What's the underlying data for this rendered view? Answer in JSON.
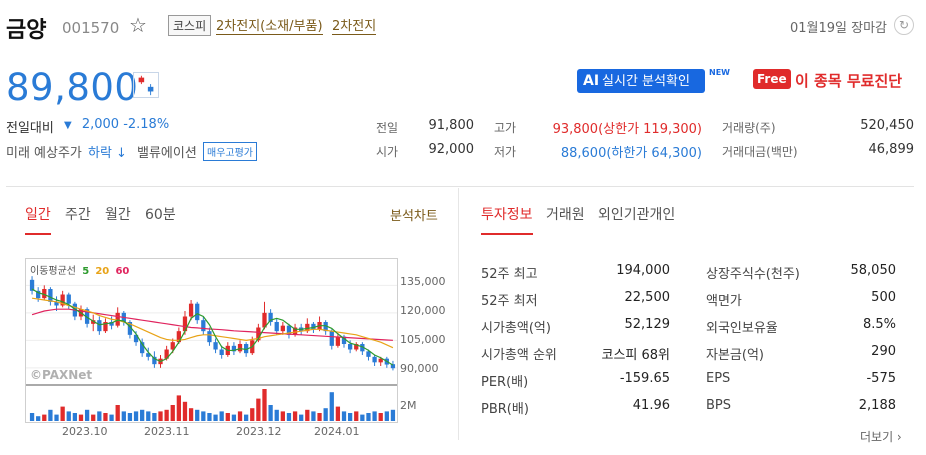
{
  "header": {
    "name": "금양",
    "code": "001570",
    "market": "코스피",
    "themes": [
      "2차전지(소재/부품)",
      "2차전지"
    ],
    "date_status": "01월19일 장마감"
  },
  "price": {
    "current": "89,800",
    "change_label": "전일대비",
    "change_arrow": "▼",
    "change_value": "2,000 -2.18%",
    "forecast_label": "미래 예상주가",
    "forecast_value": "하락 ↓",
    "valuation_label": "밸류에이션",
    "valuation_badge": "매우고평가"
  },
  "promo": {
    "ai_label": "AI",
    "ai_text": "실시간 분석확인",
    "new": "NEW",
    "free_label": "Free",
    "free_text": "이 종목 무료진단"
  },
  "quote": {
    "prev_close_label": "전일",
    "prev_close": "91,800",
    "open_label": "시가",
    "open": "92,000",
    "high_label": "고가",
    "high": "93,800(상한가 119,300)",
    "low_label": "저가",
    "low": "88,600(하한가 64,300)",
    "volume_label": "거래량(주)",
    "volume": "520,450",
    "amount_label": "거래대금(백만)",
    "amount": "46,899"
  },
  "chart_tabs": [
    "일간",
    "주간",
    "월간",
    "60분"
  ],
  "chart_link": "분석차트",
  "info_tabs": [
    "투자정보",
    "거래원",
    "외인기관개인"
  ],
  "info": {
    "left": [
      {
        "label": "52주 최고",
        "value": "194,000"
      },
      {
        "label": "52주 최저",
        "value": "22,500"
      },
      {
        "label": "시가총액(억)",
        "value": "52,129"
      },
      {
        "label": "시가총액 순위",
        "value": "코스피 68위"
      },
      {
        "label": "PER(배)",
        "value": "-159.65"
      },
      {
        "label": "PBR(배)",
        "value": "41.96"
      }
    ],
    "right": [
      {
        "label": "상장주식수(천주)",
        "value": "58,050"
      },
      {
        "label": "액면가",
        "value": "500"
      },
      {
        "label": "외국인보유율",
        "value": "8.5%"
      },
      {
        "label": "자본금(억)",
        "value": "290"
      },
      {
        "label": "EPS",
        "value": "-575"
      },
      {
        "label": "BPS",
        "value": "2,188"
      }
    ]
  },
  "more_link": "더보기 ›",
  "chart_data": {
    "type": "line",
    "legend": {
      "prefix": "이동평균선",
      "items": [
        {
          "name": "5",
          "color": "#2e9b2e"
        },
        {
          "name": "20",
          "color": "#e8a317"
        },
        {
          "name": "60",
          "color": "#e0245e"
        }
      ]
    },
    "watermark": "©PAXNet",
    "x_labels": [
      "2023.10",
      "2023.11",
      "2023.12",
      "2024.01"
    ],
    "y_labels": [
      "135,000",
      "120,000",
      "105,000",
      "90,000"
    ],
    "volume_label": "2M",
    "ylim": [
      85000,
      145000
    ],
    "candles": [
      [
        138000,
        132000,
        140000,
        130000
      ],
      [
        132000,
        128000,
        134000,
        126000
      ],
      [
        128000,
        133000,
        135000,
        127000
      ],
      [
        133000,
        126000,
        134000,
        124000
      ],
      [
        126000,
        124000,
        129000,
        121000
      ],
      [
        124000,
        130000,
        132000,
        123000
      ],
      [
        130000,
        125000,
        131000,
        122000
      ],
      [
        125000,
        118000,
        126000,
        116000
      ],
      [
        118000,
        122000,
        124000,
        116000
      ],
      [
        122000,
        114000,
        123000,
        112000
      ],
      [
        114000,
        116000,
        119000,
        110000
      ],
      [
        116000,
        110000,
        118000,
        108000
      ],
      [
        110000,
        115000,
        117000,
        109000
      ],
      [
        115000,
        113000,
        118000,
        111000
      ],
      [
        113000,
        120000,
        123000,
        112000
      ],
      [
        120000,
        115000,
        121000,
        113000
      ],
      [
        115000,
        108000,
        116000,
        106000
      ],
      [
        108000,
        104000,
        110000,
        102000
      ],
      [
        104000,
        98000,
        106000,
        96000
      ],
      [
        98000,
        96000,
        101000,
        94000
      ],
      [
        96000,
        92000,
        99000,
        90000
      ],
      [
        92000,
        95000,
        97000,
        90000
      ],
      [
        95000,
        100000,
        102000,
        94000
      ],
      [
        100000,
        104000,
        106000,
        98000
      ],
      [
        104000,
        110000,
        112000,
        103000
      ],
      [
        110000,
        118000,
        121000,
        108000
      ],
      [
        118000,
        125000,
        127000,
        116000
      ],
      [
        125000,
        116000,
        126000,
        114000
      ],
      [
        116000,
        110000,
        118000,
        108000
      ],
      [
        110000,
        104000,
        112000,
        102000
      ],
      [
        104000,
        100000,
        106000,
        98000
      ],
      [
        100000,
        97000,
        102000,
        95000
      ],
      [
        97000,
        102000,
        104000,
        96000
      ],
      [
        102000,
        99000,
        104000,
        97000
      ],
      [
        99000,
        103000,
        105000,
        98000
      ],
      [
        103000,
        98000,
        104000,
        96000
      ],
      [
        98000,
        105000,
        107000,
        97000
      ],
      [
        105000,
        112000,
        114000,
        104000
      ],
      [
        112000,
        120000,
        126000,
        111000
      ],
      [
        120000,
        115000,
        122000,
        113000
      ],
      [
        115000,
        110000,
        117000,
        108000
      ],
      [
        110000,
        113000,
        115000,
        108000
      ],
      [
        113000,
        108000,
        114000,
        106000
      ],
      [
        108000,
        112000,
        114000,
        107000
      ],
      [
        112000,
        110000,
        114000,
        108000
      ],
      [
        110000,
        114000,
        117000,
        109000
      ],
      [
        114000,
        111000,
        115000,
        109000
      ],
      [
        111000,
        115000,
        118000,
        110000
      ],
      [
        115000,
        110000,
        116000,
        108000
      ],
      [
        110000,
        102000,
        111000,
        100000
      ],
      [
        102000,
        107000,
        109000,
        101000
      ],
      [
        107000,
        103000,
        108000,
        101000
      ],
      [
        103000,
        100000,
        105000,
        98000
      ],
      [
        100000,
        103000,
        104000,
        99000
      ],
      [
        103000,
        99000,
        104000,
        97000
      ],
      [
        99000,
        96000,
        100000,
        94000
      ],
      [
        96000,
        93000,
        97000,
        91000
      ],
      [
        93000,
        95000,
        96000,
        91000
      ],
      [
        95000,
        91800,
        96000,
        90000
      ],
      [
        92000,
        89800,
        93800,
        88600
      ]
    ],
    "ma5": [
      133000,
      131000,
      130000,
      128500,
      127000,
      126000,
      124500,
      122000,
      120000,
      117500,
      115500,
      113500,
      114000,
      114500,
      116000,
      115500,
      112500,
      108500,
      103000,
      98500,
      95000,
      93500,
      95000,
      99000,
      104000,
      110000,
      117000,
      119500,
      118000,
      113500,
      107000,
      101500,
      99500,
      99500,
      100500,
      100000,
      101500,
      106000,
      112000,
      116000,
      117000,
      116000,
      113500,
      111000,
      111000,
      111500,
      112000,
      113000,
      113000,
      111500,
      108500,
      106000,
      103500,
      102500,
      101500,
      99500,
      97000,
      95500,
      93500,
      91500
    ],
    "ma20": [
      128000,
      127500,
      127000,
      126500,
      126000,
      125000,
      124000,
      123000,
      122000,
      121000,
      120000,
      118500,
      117500,
      116500,
      116000,
      115000,
      114000,
      112500,
      111000,
      109500,
      108000,
      106500,
      105500,
      105000,
      105000,
      105500,
      106500,
      107500,
      108000,
      108000,
      107500,
      107000,
      106500,
      106000,
      105500,
      105000,
      105500,
      106000,
      107000,
      107500,
      108000,
      108500,
      109000,
      109500,
      110000,
      110500,
      111000,
      111000,
      110500,
      110000,
      109500,
      109000,
      108500,
      108000,
      107000,
      106000,
      105000,
      104000,
      102500,
      101000
    ],
    "ma60": [
      119000,
      120000,
      121000,
      121500,
      122000,
      122000,
      122000,
      121500,
      121000,
      120500,
      120000,
      119500,
      119000,
      118500,
      118000,
      117500,
      117000,
      116500,
      116000,
      115500,
      115000,
      114500,
      114000,
      113500,
      113000,
      112500,
      112000,
      111800,
      111500,
      111200,
      111000,
      110800,
      110500,
      110200,
      110000,
      109800,
      109600,
      109400,
      109200,
      109000,
      108800,
      108600,
      108400,
      108200,
      108000,
      107800,
      107600,
      107400,
      107200,
      107000,
      106800,
      106600,
      106400,
      106200,
      106000,
      105800,
      105600,
      105400,
      105200,
      105000
    ],
    "volume": [
      0.25,
      0.15,
      0.2,
      0.35,
      0.2,
      0.45,
      0.3,
      0.25,
      0.2,
      0.35,
      0.2,
      0.3,
      0.25,
      0.2,
      0.5,
      0.3,
      0.25,
      0.3,
      0.35,
      0.3,
      0.25,
      0.3,
      0.35,
      0.5,
      0.8,
      0.6,
      0.4,
      0.35,
      0.3,
      0.25,
      0.2,
      0.3,
      0.25,
      0.2,
      0.3,
      0.2,
      0.4,
      0.7,
      1.0,
      0.5,
      0.35,
      0.3,
      0.25,
      0.3,
      0.2,
      0.35,
      0.3,
      0.25,
      0.4,
      0.9,
      0.45,
      0.3,
      0.25,
      0.3,
      0.2,
      0.25,
      0.3,
      0.25,
      0.3,
      0.35
    ]
  }
}
